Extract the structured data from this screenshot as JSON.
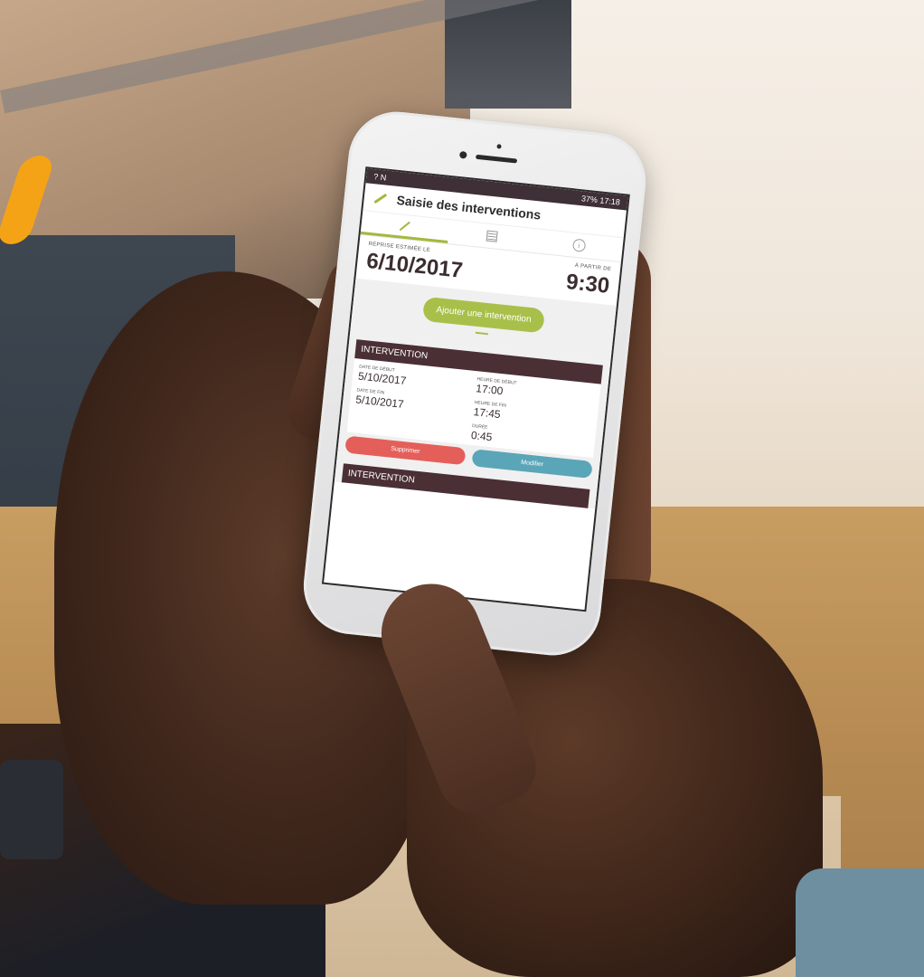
{
  "phone": {
    "statusbar": {
      "left_icons": "? N",
      "right_text": "37% 17:18"
    },
    "appbar": {
      "title": "Saisie des interventions"
    },
    "tabs": [
      {
        "icon": "pencil-icon",
        "active": true
      },
      {
        "icon": "list-icon",
        "active": false
      },
      {
        "icon": "info-icon",
        "active": false
      }
    ],
    "summary": {
      "date_label": "Reprise estimée le",
      "date_value": "6/10/2017",
      "time_label": "À partir de",
      "time_value": "9:30"
    },
    "add_button_label": "Ajouter une intervention",
    "interventions": [
      {
        "header": "Intervention",
        "start_date_label": "Date de début",
        "start_date": "5/10/2017",
        "start_time_label": "Heure de début",
        "start_time": "17:00",
        "end_date_label": "Date de fin",
        "end_date": "5/10/2017",
        "end_time_label": "Heure de fin",
        "end_time": "17:45",
        "duration_label": "Durée",
        "duration": "0:45",
        "delete_label": "Supprimer",
        "edit_label": "Modifier"
      }
    ],
    "next_header": "Intervention"
  },
  "colors": {
    "accent_green": "#a8c04a",
    "header_brown": "#4a2f35",
    "delete_red": "#e45f5a",
    "edit_blue": "#5ba5b8",
    "brand_orange": "#f5a316"
  }
}
